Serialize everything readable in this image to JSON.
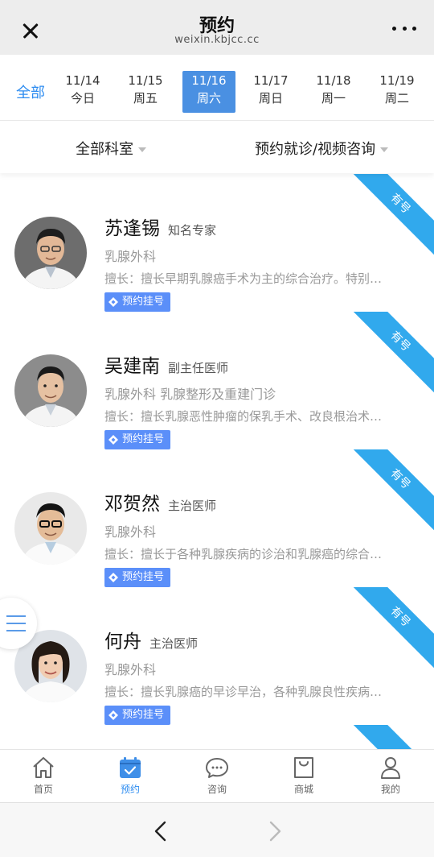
{
  "header": {
    "title": "预约",
    "subtitle": "weixin.kbjcc.cc"
  },
  "date_tabs": {
    "all_label": "全部",
    "dates": [
      {
        "date": "11/14",
        "weekday": "今日",
        "active": false
      },
      {
        "date": "11/15",
        "weekday": "周五",
        "active": false
      },
      {
        "date": "11/16",
        "weekday": "周六",
        "active": true
      },
      {
        "date": "11/17",
        "weekday": "周日",
        "active": false
      },
      {
        "date": "11/18",
        "weekday": "周一",
        "active": false
      },
      {
        "date": "11/19",
        "weekday": "周二",
        "active": false
      }
    ]
  },
  "filters": {
    "department": "全部科室",
    "type": "预约就诊/视频咨询"
  },
  "doctors": [
    {
      "name": "苏逢锡",
      "title": "知名专家",
      "dept": "乳腺外科",
      "skill": "擅长：擅长早期乳腺癌手术为主的综合治疗。特别…",
      "badge": "预约挂号",
      "ribbon": "有号"
    },
    {
      "name": "吴建南",
      "title": "副主任医师",
      "dept": "乳腺外科  乳腺整形及重建门诊",
      "skill": "擅长：擅长乳腺恶性肿瘤的保乳手术、改良根治术…",
      "badge": "预约挂号",
      "ribbon": "有号"
    },
    {
      "name": "邓贺然",
      "title": "主治医师",
      "dept": "乳腺外科",
      "skill": "擅长：擅长于各种乳腺疾病的诊治和乳腺癌的综合…",
      "badge": "预约挂号",
      "ribbon": "有号"
    },
    {
      "name": "何舟",
      "title": "主治医师",
      "dept": "乳腺外科",
      "skill": "擅长：擅长乳腺癌的早诊早治，各种乳腺良性疾病…",
      "badge": "预约挂号",
      "ribbon": "有号"
    }
  ],
  "tabbar": {
    "items": [
      {
        "label": "首页",
        "icon": "home-icon",
        "active": false
      },
      {
        "label": "预约",
        "icon": "calendar-icon",
        "active": true
      },
      {
        "label": "咨询",
        "icon": "chat-icon",
        "active": false
      },
      {
        "label": "商城",
        "icon": "shopping-bag-icon",
        "active": false
      },
      {
        "label": "我的",
        "icon": "user-icon",
        "active": false
      }
    ]
  },
  "colors": {
    "accent": "#2d8cf0",
    "active_date_bg": "#4a90e2",
    "badge_bg": "#5b8ff9",
    "ribbon_bg": "#31a9ed"
  }
}
